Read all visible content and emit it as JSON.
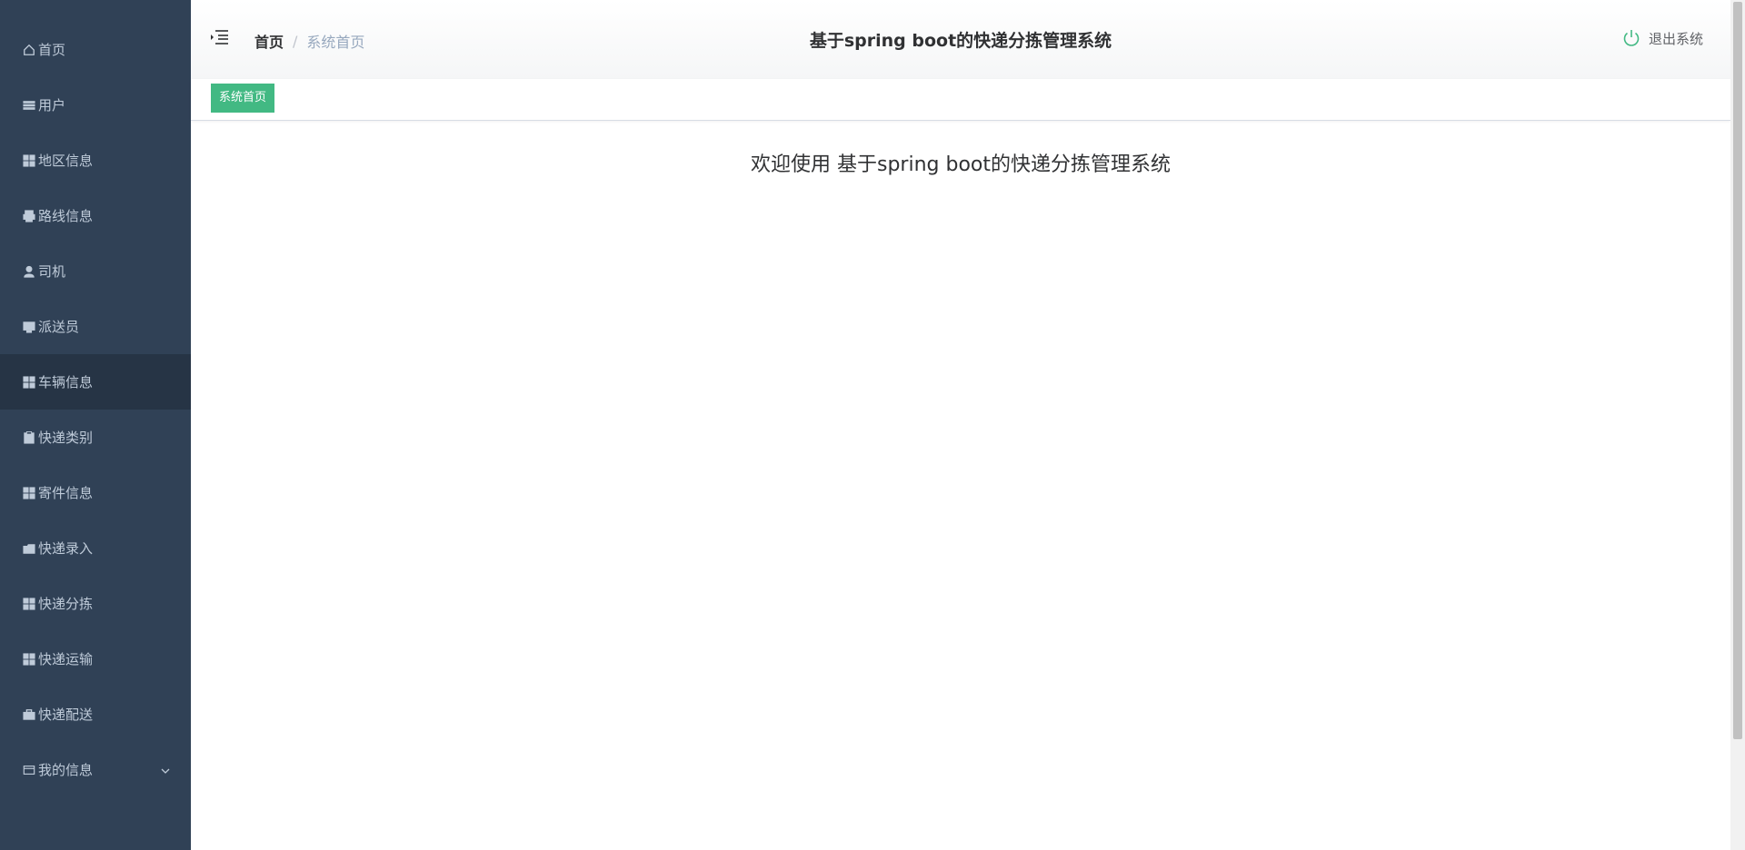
{
  "sidebar": {
    "items": [
      {
        "label": "首页",
        "icon": "home-icon"
      },
      {
        "label": "用户",
        "icon": "list-icon"
      },
      {
        "label": "地区信息",
        "icon": "grid-icon"
      },
      {
        "label": "路线信息",
        "icon": "print-icon"
      },
      {
        "label": "司机",
        "icon": "user-icon"
      },
      {
        "label": "派送员",
        "icon": "monitor-icon"
      },
      {
        "label": "车辆信息",
        "icon": "grid-icon"
      },
      {
        "label": "快递类别",
        "icon": "clipboard-icon"
      },
      {
        "label": "寄件信息",
        "icon": "grid-icon"
      },
      {
        "label": "快递录入",
        "icon": "folder-icon"
      },
      {
        "label": "快递分拣",
        "icon": "grid-icon"
      },
      {
        "label": "快递运输",
        "icon": "grid-icon"
      },
      {
        "label": "快递配送",
        "icon": "briefcase-icon"
      },
      {
        "label": "我的信息",
        "icon": "wallet-icon"
      }
    ],
    "colors": {
      "background": "#304156",
      "active": "#263445",
      "text": "#bfcbd9"
    }
  },
  "header": {
    "breadcrumb_home": "首页",
    "breadcrumb_separator": "/",
    "breadcrumb_current": "系统首页",
    "title": "基于spring boot的快递分拣管理系统",
    "logout_label": "退出系统",
    "colors": {
      "logout_icon": "#42b983"
    }
  },
  "tags": {
    "active_tag": "系统首页",
    "colors": {
      "tag": "#42b983"
    }
  },
  "main": {
    "welcome": "欢迎使用 基于spring boot的快递分拣管理系统"
  }
}
